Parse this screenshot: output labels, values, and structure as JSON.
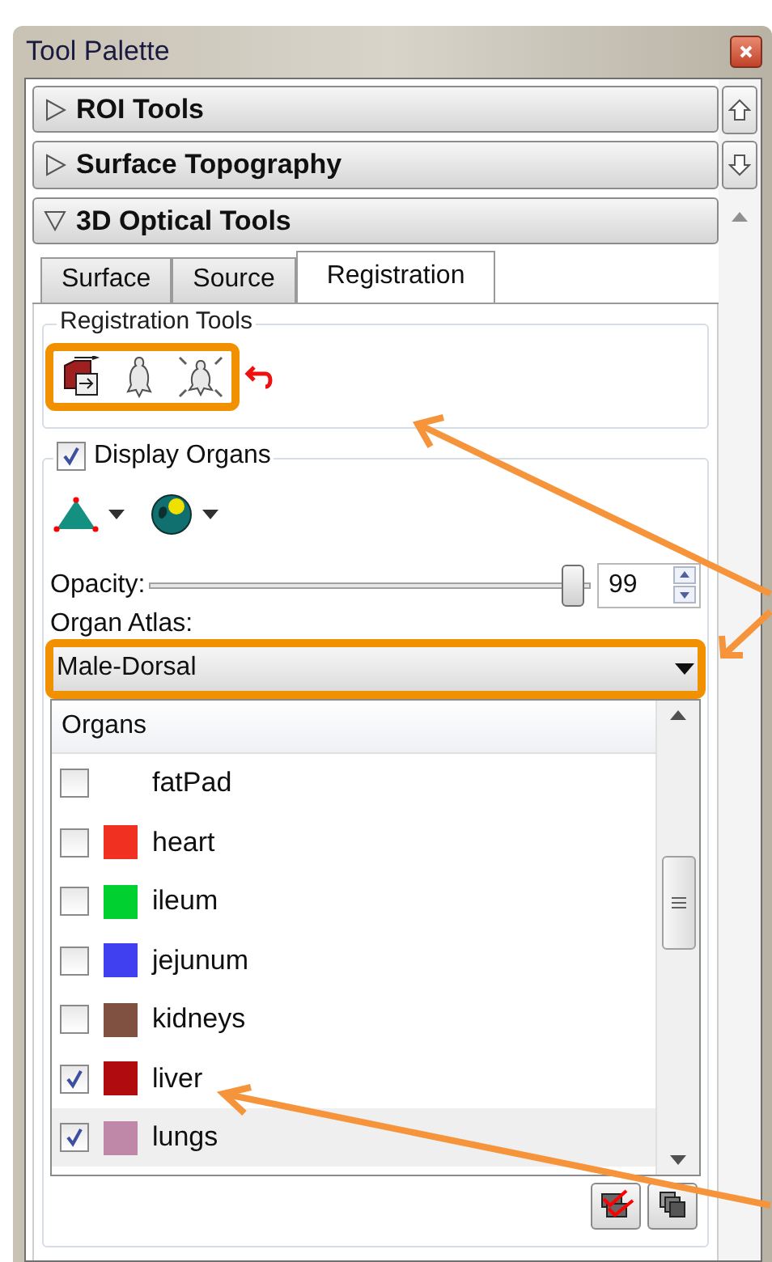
{
  "window": {
    "title": "Tool Palette"
  },
  "sections": [
    {
      "label": "ROI Tools",
      "expanded": false
    },
    {
      "label": "Surface Topography",
      "expanded": false
    },
    {
      "label": "3D Optical Tools",
      "expanded": true
    }
  ],
  "tabs": [
    {
      "label": "Surface",
      "selected": false
    },
    {
      "label": "Source",
      "selected": false
    },
    {
      "label": "Registration",
      "selected": true
    }
  ],
  "registration_tools": {
    "title": "Registration Tools"
  },
  "display_organs": {
    "label": "Display Organs",
    "checked": true
  },
  "opacity": {
    "label": "Opacity:",
    "level": 0.99,
    "value": "99"
  },
  "organ_atlas": {
    "label": "Organ Atlas:",
    "value": "Male-Dorsal"
  },
  "organs": {
    "header": "Organs",
    "rows": [
      {
        "name": "fatPad",
        "checked": false,
        "selected": false
      },
      {
        "name": "heart",
        "color": "#f03020",
        "checked": false,
        "selected": false
      },
      {
        "name": "ileum",
        "color": "#00d030",
        "checked": false,
        "selected": false
      },
      {
        "name": "jejunum",
        "color": "#4040f0",
        "checked": false,
        "selected": false
      },
      {
        "name": "kidneys",
        "color": "#805040",
        "checked": false,
        "selected": false
      },
      {
        "name": "liver",
        "color": "#b00c10",
        "checked": true,
        "selected": false
      },
      {
        "name": "lungs",
        "color": "#c088a8",
        "checked": true,
        "selected": true
      }
    ]
  }
}
